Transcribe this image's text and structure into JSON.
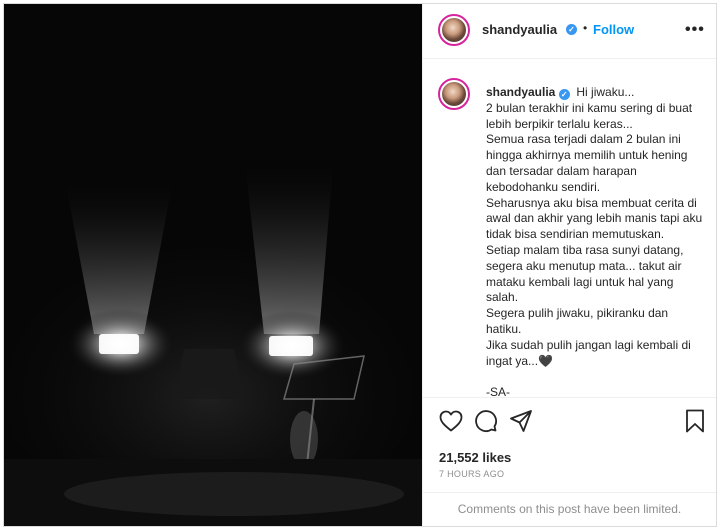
{
  "post": {
    "username": "shandyaulia",
    "verified_icon": "verified-badge-icon",
    "separator": "•",
    "follow_label": "Follow",
    "more_label": "•••",
    "caption_lines": [
      "Hi jiwaku...",
      "2 bulan terakhir ini kamu sering di buat",
      "lebih berpikir terlalu keras...",
      "Semua rasa terjadi dalam 2 bulan ini",
      "hingga akhirnya memilih untuk hening",
      "dan tersadar dalam harapan",
      "kebodohanku sendiri.",
      "Seharusnya aku bisa membuat cerita di",
      "awal dan akhir yang lebih manis tapi aku",
      "tidak bisa sendirian memutuskan.",
      "Setiap malam tiba rasa sunyi datang,",
      "segera aku menutup mata... takut air",
      "mataku kembali lagi untuk hal yang",
      "salah.",
      "Segera pulih jiwaku, pikiranku dan",
      "hatiku.",
      "Jika sudah pulih jangan lagi kembali di",
      "ingat ya...🖤",
      "",
      "-SA-"
    ],
    "likes": "21,552 likes",
    "time": "7 HOURS AGO",
    "comments_notice": "Comments on this post have been limited.",
    "icons": [
      "heart-icon",
      "comment-icon",
      "share-icon",
      "bookmark-icon"
    ],
    "colors": {
      "link": "#0095f6",
      "verified": "#3897f0",
      "text": "#262626",
      "muted": "#8e8e8e"
    }
  }
}
